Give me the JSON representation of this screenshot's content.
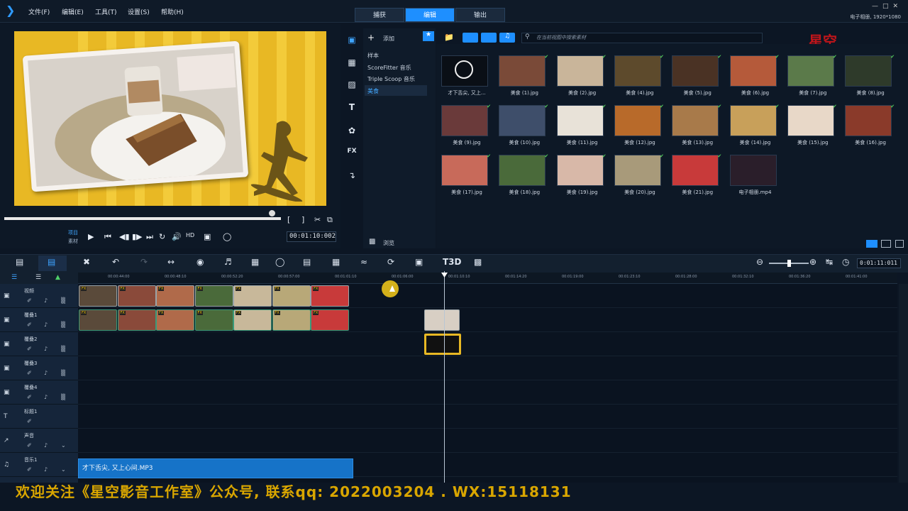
{
  "menu": {
    "file": "文件(F)",
    "edit": "编辑(E)",
    "tools": "工具(T)",
    "settings": "设置(S)",
    "help": "帮助(H)"
  },
  "mode_tabs": [
    "捕获",
    "编辑",
    "输出"
  ],
  "project_info": "电子相册, 1920*1080",
  "preview": {
    "mode_project": "项目",
    "mode_clip": "素材",
    "timecode": "00:01:10:002"
  },
  "library": {
    "add_label": "添加",
    "nav_items": [
      "样本",
      "ScoreFitter 音乐",
      "Triple Scoop 音乐",
      "美食"
    ],
    "browse_label": "浏览",
    "search_placeholder": "在当前视图中搜索素材",
    "items": [
      "才下舌尖, 又上...",
      "美食 (1).jpg",
      "美食 (2).jpg",
      "美食 (4).jpg",
      "美食 (5).jpg",
      "美食 (6).jpg",
      "美食 (7).jpg",
      "美食 (8).jpg",
      "美食 (9).jpg",
      "美食 (10).jpg",
      "美食 (11).jpg",
      "美食 (12).jpg",
      "美食 (13).jpg",
      "美食 (14).jpg",
      "美食 (15).jpg",
      "美食 (16).jpg",
      "美食 (17).jpg",
      "美食 (18).jpg",
      "美食 (19).jpg",
      "美食 (20).jpg",
      "美食 (21).jpg",
      "电子相册.mp4"
    ]
  },
  "timeline": {
    "timecode": "0:01:11:011",
    "ruler": [
      "00:00:44:00",
      "00:00:48:10",
      "00:00:52:20",
      "00:00:57:00",
      "00:01:01:10",
      "00:01:06:00",
      "00:01:10:10",
      "00:01:14:20",
      "00:01:19:00",
      "00:01:23:10",
      "00:01:28:00",
      "00:01:32:10",
      "00:01:36:20",
      "00:01:41:00"
    ],
    "tracks": [
      "视频",
      "覆叠1",
      "覆叠2",
      "覆叠3",
      "覆叠4",
      "标题1",
      "声音",
      "音乐1"
    ],
    "music_clip": "才下舌尖, 又上心间.MP3"
  },
  "banner": "欢迎关注《星空影音工作室》公众号, 联系qq: 2022003204 . WX:15118131",
  "colors": {
    "accent": "#1e8fff",
    "screen_bg": "#e8b824",
    "music_clip": "#1673c8"
  }
}
